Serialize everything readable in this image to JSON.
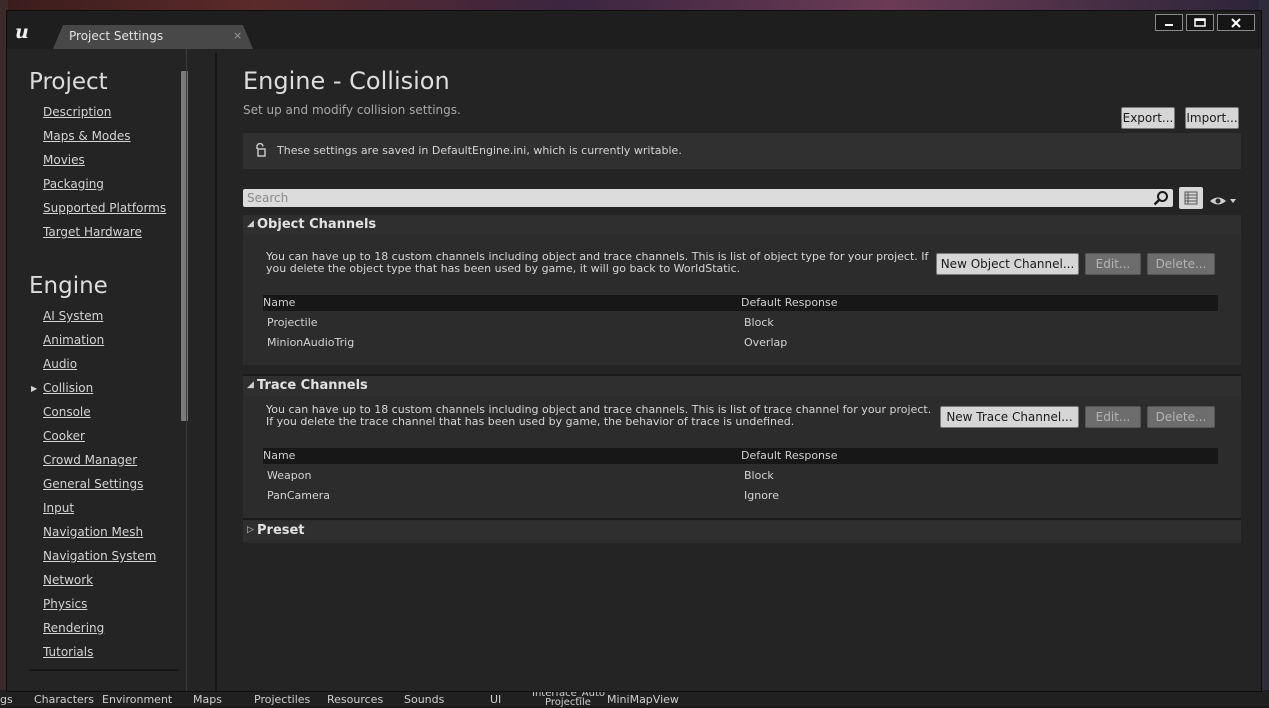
{
  "window": {
    "tab_title": "Project Settings",
    "tab_close": "×",
    "logo": "u",
    "buttons": {
      "minimize": "▁",
      "maximize": "▭",
      "close": "✕"
    }
  },
  "sidebar": {
    "project_heading": "Project",
    "project_items": [
      "Description",
      "Maps & Modes",
      "Movies",
      "Packaging",
      "Supported Platforms",
      "Target Hardware"
    ],
    "engine_heading": "Engine",
    "engine_items": [
      "AI System",
      "Animation",
      "Audio",
      "Collision",
      "Console",
      "Cooker",
      "Crowd Manager",
      "General Settings",
      "Input",
      "Navigation Mesh",
      "Navigation System",
      "Network",
      "Physics",
      "Rendering",
      "Tutorials"
    ],
    "selected": "Collision"
  },
  "main": {
    "title": "Engine - Collision",
    "subtitle": "Set up and modify collision settings.",
    "export_label": "Export...",
    "import_label": "Import...",
    "info_text": "These settings are saved in DefaultEngine.ini, which is currently writable.",
    "search_placeholder": "Search",
    "object_channels": {
      "title": "Object Channels",
      "description": "You can have up to 18 custom channels including object and trace channels. This is list of object type for your project. If you delete the object type that has been used by game, it will go back to WorldStatic.",
      "new_label": "New Object Channel...",
      "edit_label": "Edit...",
      "delete_label": "Delete...",
      "col_name": "Name",
      "col_response": "Default Response",
      "rows": [
        {
          "name": "Projectile",
          "response": "Block"
        },
        {
          "name": "MinionAudioTrig",
          "response": "Overlap"
        }
      ]
    },
    "trace_channels": {
      "title": "Trace Channels",
      "description": "You can have up to 18 custom channels including object and trace channels. This is list of trace channel for your project. If you delete the trace channel that has been used by game, the behavior of trace is undefined.",
      "new_label": "New Trace Channel...",
      "edit_label": "Edit...",
      "delete_label": "Delete...",
      "col_name": "Name",
      "col_response": "Default Response",
      "rows": [
        {
          "name": "Weapon",
          "response": "Block"
        },
        {
          "name": "PanCamera",
          "response": "Ignore"
        }
      ]
    },
    "preset": {
      "title": "Preset"
    }
  },
  "background_tabs": {
    "items": [
      "gs",
      "Characters",
      "Environment",
      "Maps",
      "Projectiles",
      "Resources",
      "Sounds",
      "UI",
      "Interface_Auto Projectile",
      "MiniMapView"
    ]
  }
}
